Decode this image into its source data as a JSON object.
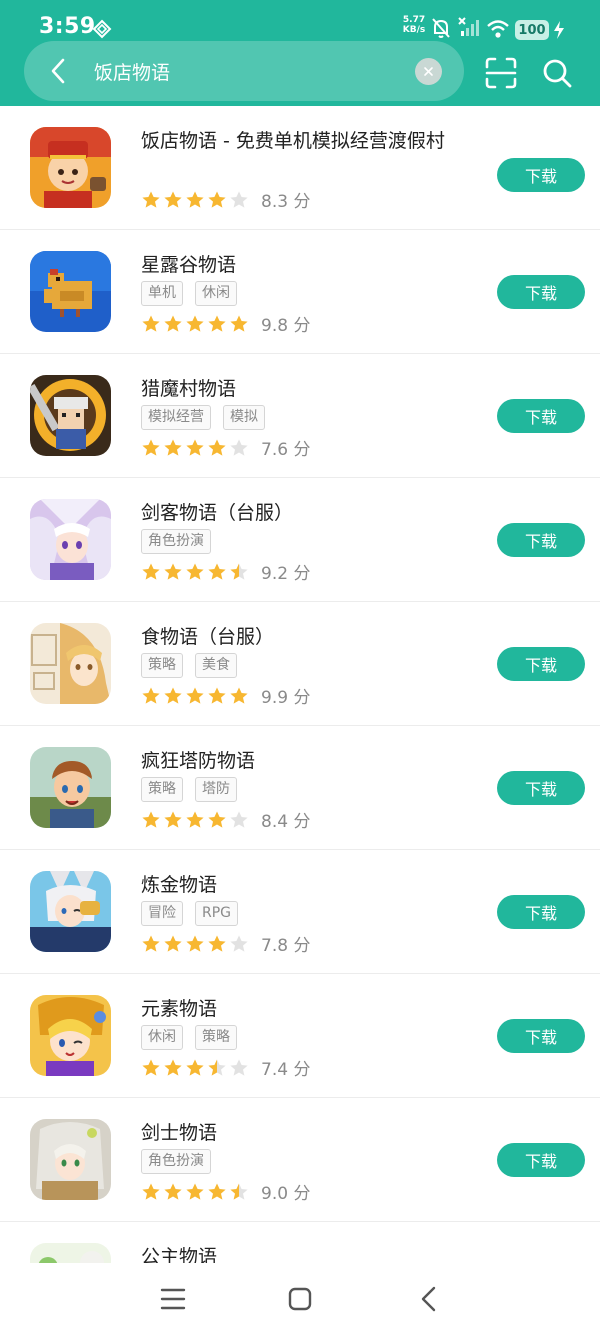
{
  "status": {
    "time": "3:59",
    "net_speed_value": "5.77",
    "net_speed_unit": "KB/s",
    "battery": "100"
  },
  "search": {
    "query": "饭店物语",
    "placeholder": ""
  },
  "colors": {
    "accent": "#21b79c",
    "star": "#f7b731",
    "star_empty": "#e2e2e2"
  },
  "list": {
    "download_label": "下载",
    "apps": [
      {
        "name": "饭店物语 - 免费单机模拟经营渡假村",
        "tags": [],
        "rating": 4,
        "score": "8.3 分"
      },
      {
        "name": "星露谷物语",
        "tags": [
          "单机",
          "休闲"
        ],
        "rating": 5,
        "score": "9.8 分"
      },
      {
        "name": "猎魔村物语",
        "tags": [
          "模拟经营",
          "模拟"
        ],
        "rating": 4,
        "score": "7.6 分"
      },
      {
        "name": "剑客物语（台服）",
        "tags": [
          "角色扮演"
        ],
        "rating": 4.5,
        "score": "9.2 分"
      },
      {
        "name": "食物语（台服）",
        "tags": [
          "策略",
          "美食"
        ],
        "rating": 5,
        "score": "9.9 分"
      },
      {
        "name": "疯狂塔防物语",
        "tags": [
          "策略",
          "塔防"
        ],
        "rating": 4,
        "score": "8.4 分"
      },
      {
        "name": "炼金物语",
        "tags": [
          "冒险",
          "RPG"
        ],
        "rating": 4,
        "score": "7.8 分"
      },
      {
        "name": "元素物语",
        "tags": [
          "休闲",
          "策略"
        ],
        "rating": 3.5,
        "score": "7.4 分"
      },
      {
        "name": "剑士物语",
        "tags": [
          "角色扮演"
        ],
        "rating": 4.5,
        "score": "9.0 分"
      },
      {
        "name": "公主物语",
        "tags": [],
        "rating": 0,
        "score": ""
      }
    ]
  }
}
